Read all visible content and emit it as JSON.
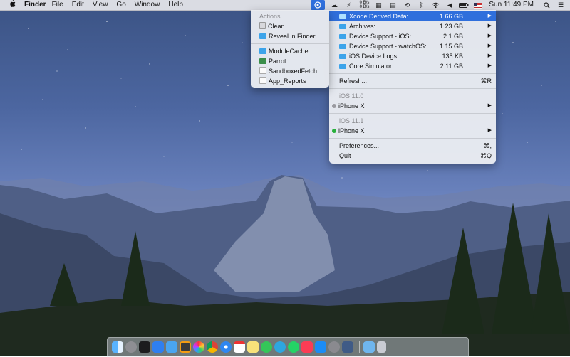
{
  "menubar": {
    "app_name": "Finder",
    "menus": [
      "File",
      "Edit",
      "View",
      "Go",
      "Window",
      "Help"
    ],
    "netspeed_up": "0 B/s",
    "netspeed_down": "0 B/s",
    "clock": "Sun 11:49 PM"
  },
  "main_menu": {
    "items": [
      {
        "label": "Xcode Derived Data:",
        "size": "1.66 GB"
      },
      {
        "label": "Archives:",
        "size": "1.23 GB"
      },
      {
        "label": "Device Support - iOS:",
        "size": "2.1 GB"
      },
      {
        "label": "Device Support - watchOS:",
        "size": "1.15 GB"
      },
      {
        "label": "iOS Device Logs:",
        "size": "135 KB"
      },
      {
        "label": "Core Simulator:",
        "size": "2.11 GB"
      }
    ],
    "refresh_label": "Refresh...",
    "refresh_shortcut": "⌘R",
    "ios_110_header": "iOS 11.0",
    "iphone_a": "iPhone X",
    "ios_111_header": "iOS 11.1",
    "iphone_b": "iPhone X",
    "preferences_label": "Preferences...",
    "preferences_shortcut": "⌘,",
    "quit_label": "Quit",
    "quit_shortcut": "⌘Q"
  },
  "submenu": {
    "header": "Actions",
    "clean": "Clean...",
    "reveal": "Reveal in Finder...",
    "folders": [
      "ModuleCache",
      "Parrot",
      "SandboxedFetch",
      "App_Reports"
    ]
  },
  "colors": {
    "highlight": "#2f6fdc",
    "folder": "#3da4ea",
    "dot_gray": "#9a9aa0",
    "dot_green": "#28b03c"
  },
  "dock_icons": [
    "finder-icon",
    "launchpad-icon",
    "terminal-icon",
    "xcode-icon",
    "folder-icon",
    "sublime-icon",
    "photos-icon",
    "chrome-icon",
    "safari-icon",
    "calendar-icon",
    "notes-icon",
    "messages-icon",
    "telegram-icon",
    "whatsapp-icon",
    "music-icon",
    "appstore-icon",
    "settings-icon",
    "app-icon",
    "downloads-icon",
    "trash-icon"
  ]
}
